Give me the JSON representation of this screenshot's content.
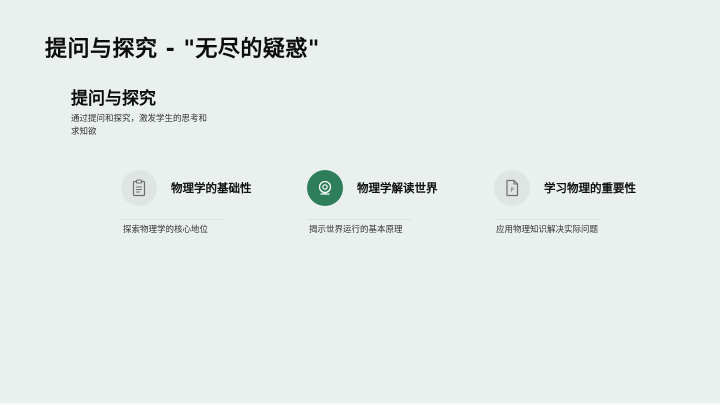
{
  "slide": {
    "title": "提问与探究 - \"无尽的疑惑\"",
    "section_heading": "提问与探究",
    "section_description": "通过提问和探究，激发学生的思考和求知欲"
  },
  "cards": [
    {
      "title": "物理学的基础性",
      "description": "探索物理学的核心地位",
      "icon": "clipboard-icon",
      "highlighted": false
    },
    {
      "title": "物理学解读世界",
      "description": "揭示世界运行的基本原理",
      "icon": "webcam-icon",
      "highlighted": true
    },
    {
      "title": "学习物理的重要性",
      "description": "应用物理知识解决实际问题",
      "icon": "document-p-icon",
      "highlighted": false
    }
  ],
  "colors": {
    "background": "#e9f0ed",
    "accent": "#2e7d5b",
    "icon_circle": "#dfe5e2"
  }
}
